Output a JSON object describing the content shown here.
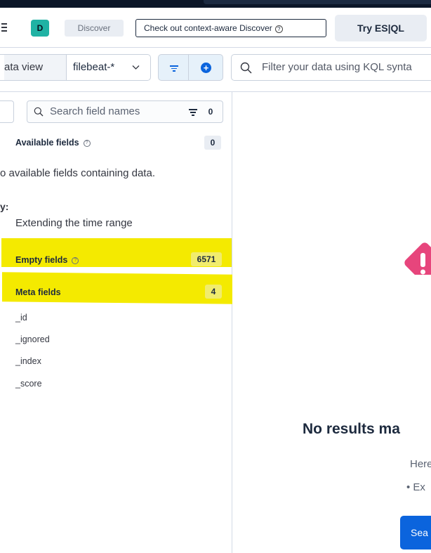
{
  "header": {
    "space_initial": "D",
    "breadcrumb": "Discover",
    "context_button": "Check out context-aware Discover",
    "esql_button": "Try ES|QL"
  },
  "query_bar": {
    "data_view_label": "ata view",
    "data_view_value": "filebeat-*",
    "kql_placeholder": "Filter your data using KQL synta"
  },
  "sidebar": {
    "search_placeholder": "Search field names",
    "filter_count": "0",
    "available": {
      "title": "Available fields",
      "count": "0"
    },
    "no_fields_message": "o available fields containing data.",
    "try_label": "y:",
    "suggestion": "Extending the time range",
    "empty": {
      "title": "Empty fields",
      "count": "6571"
    },
    "meta": {
      "title": "Meta fields",
      "count": "4",
      "items": [
        "_id",
        "_ignored",
        "_index",
        "_score"
      ]
    }
  },
  "main": {
    "no_results": "No results ma",
    "here_text": "Here a",
    "bullet_text": "• Ex",
    "search_button": "Sea"
  },
  "colors": {
    "highlight": "#f4ea00",
    "primary": "#0b64dd",
    "teal": "#20b2a4",
    "pink": "#e7457c",
    "salmon": "#f5a07c"
  }
}
